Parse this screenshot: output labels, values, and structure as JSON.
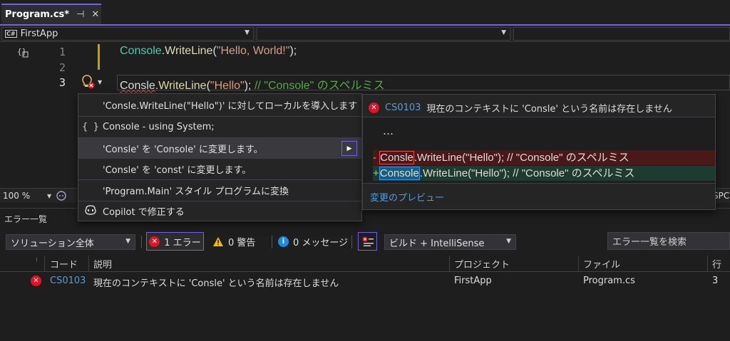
{
  "tab": {
    "title": "Program.cs*",
    "pin_glyph": "⊣",
    "close_glyph": "✕"
  },
  "navbar": {
    "project": "FirstApp",
    "project_badge": "C#"
  },
  "editor": {
    "line1": {
      "num": "1",
      "cls": "Console",
      "dot": ".",
      "method": "WriteLine",
      "open": "(",
      "str": "\"Hello, World!\"",
      "close": ");"
    },
    "line2": {
      "num": "2"
    },
    "line3": {
      "num": "3",
      "cls": "Consle",
      "dot": ".",
      "method": "WriteLine",
      "open": "(",
      "str": "\"Hello\"",
      "close": ");",
      "comment": " // \"Console\" のスペルミス"
    }
  },
  "menu": {
    "items": [
      {
        "icon": "",
        "label": "'Consle.WriteLine(\"Hello\")' に対してローカルを導入します"
      },
      {
        "icon": "{ }",
        "label": "Console - using System;"
      },
      {
        "icon": "",
        "label": "'Consle' を 'Console' に変更します。"
      },
      {
        "icon": "",
        "label": "'Consle' を 'const' に変更します。"
      },
      {
        "icon": "",
        "label": "'Program.Main' スタイル プログラムに変換"
      },
      {
        "icon": "",
        "label": "Copilot で修正する"
      }
    ]
  },
  "preview": {
    "error_code": "CS0103",
    "error_message": "現在のコンテキストに 'Consle' という名前は存在しません",
    "ellipsis": "…",
    "removed": {
      "sign": "-",
      "word": "Consle",
      "rest": ".WriteLine(\"Hello\"); // \"Console\" のスペルミス"
    },
    "added": {
      "sign": "+",
      "word": "Console",
      "rest": ".WriteLine(\"Hello\"); // \"Console\" のスペルミス"
    },
    "preview_link": "変更のプレビュー"
  },
  "zoombar": {
    "zoom": "100 %",
    "right_text": "SPC"
  },
  "errorlist": {
    "title": "エラー一覧",
    "scope": "ソリューション全体",
    "errors_label": "1 エラー",
    "warnings_label": "0 警告",
    "messages_label": "0 メッセージ",
    "build_filter": "ビルド + IntelliSense",
    "search_placeholder": "エラー一覧を検索",
    "columns": {
      "code": "コード",
      "description": "説明",
      "project": "プロジェクト",
      "file": "ファイル",
      "line": "行"
    },
    "rows": [
      {
        "code": "CS0103",
        "description": "現在のコンテキストに 'Consle' という名前は存在しません",
        "project": "FirstApp",
        "file": "Program.cs",
        "line": "3"
      }
    ]
  },
  "colors": {
    "accent": "#7160e8",
    "error": "#e81123",
    "link": "#569cd6",
    "type": "#4ec9b0",
    "string": "#d69d85",
    "comment": "#57a64a"
  }
}
